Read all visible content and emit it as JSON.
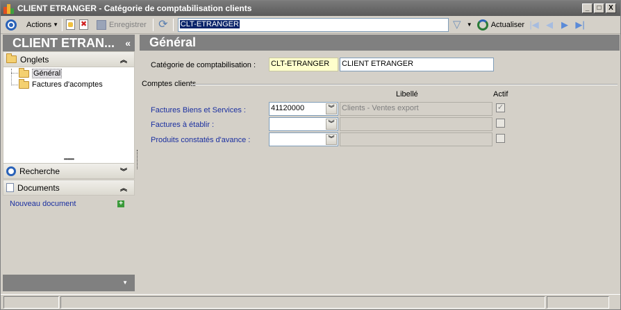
{
  "window": {
    "title_code": "CLIENT ETRANGER",
    "title_separator": "-",
    "title_desc": "Catégorie de comptabilisation clients",
    "buttons": {
      "minimize": "_",
      "maximize": "□",
      "close": "X"
    }
  },
  "toolbar": {
    "actions_label": "Actions",
    "save_label": "Enregistrer",
    "search_value": "CLT-ETRANGER",
    "refresh_label": "Actualiser"
  },
  "sidebar": {
    "header_title": "CLIENT ETRAN...",
    "header_chevron": "«",
    "onglets_label": "Onglets",
    "tree_items": [
      {
        "label": "Général",
        "selected": true
      },
      {
        "label": "Factures d'acomptes",
        "selected": false
      }
    ],
    "recherche_label": "Recherche",
    "documents_label": "Documents",
    "new_document_label": "Nouveau document",
    "splitter_dots": "••••••••"
  },
  "main": {
    "header_title": "Général",
    "category_label": "Catégorie de comptabilisation :",
    "category_code": "CLT-ETRANGER",
    "category_name": "CLIENT ETRANGER",
    "group_title": "Comptes clients",
    "col_libelle": "Libellé",
    "col_actif": "Actif",
    "rows": [
      {
        "label": "Factures Biens et Services :",
        "account": "41120000",
        "libelle": "Clients - Ventes export",
        "actif": true
      },
      {
        "label": "Factures à établir :",
        "account": "",
        "libelle": "",
        "actif": false
      },
      {
        "label": "Produits constatés d'avance :",
        "account": "",
        "libelle": "",
        "actif": false
      }
    ]
  },
  "colors": {
    "header_gray": "#808080",
    "link_blue": "#1a2fa0",
    "field_yellow": "#ffffcc"
  }
}
